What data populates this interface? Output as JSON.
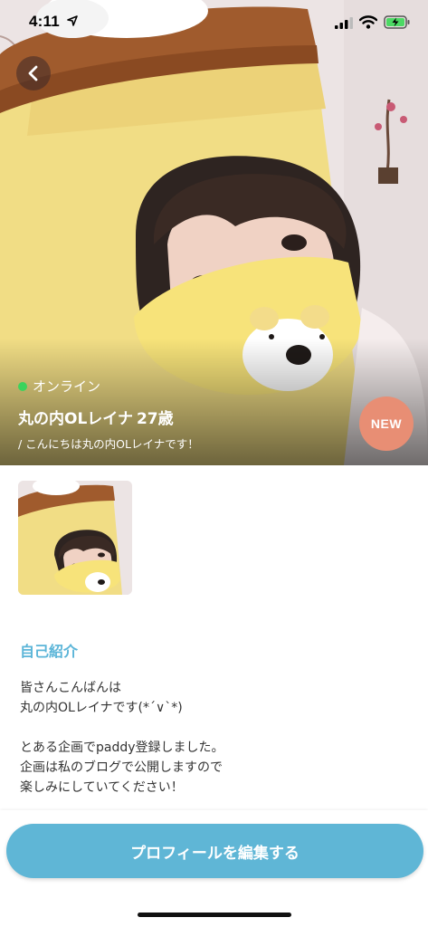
{
  "status_bar": {
    "time": "4:11"
  },
  "profile": {
    "online_status": "オンライン",
    "name": "丸の内OLレイナ",
    "age": "27歳",
    "tagline": "/ こんにちは丸の内OLレイナです！",
    "badge": "NEW"
  },
  "bio": {
    "heading": "自己紹介",
    "lines": [
      "皆さんこんばんは",
      "丸の内OLレイナです(*´∨`*)",
      "",
      "とある企画でpaddy登録しました。",
      "企画は私のブログで公開しますので",
      "楽しみにしていてください！"
    ]
  },
  "actions": {
    "edit_profile": "プロフィールを編集する"
  },
  "colors": {
    "accent": "#5fb6d6",
    "heading": "#5bb5d8",
    "online": "#3cd35c",
    "new_badge": "#e88e74"
  }
}
